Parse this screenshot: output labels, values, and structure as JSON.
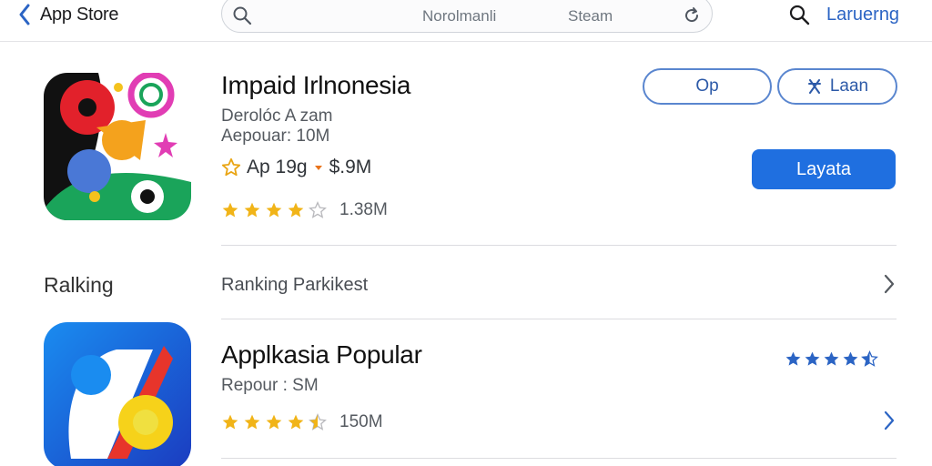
{
  "header": {
    "back_label": "App Store",
    "search_text": "Norolmanli",
    "search_secondary": "Steam",
    "lang_label": "Laruerng"
  },
  "featured": {
    "title": "Impaid Irlnonesia",
    "developer": "Derolóc A zam",
    "popular": "Aepouar: 10M",
    "meta": "Ap 19g",
    "meta_size": "$.9M",
    "rating_count": "1.38M",
    "rating_stars": 4.5,
    "open_button": "Op",
    "share_button": "Laan",
    "primary_button": "Layata"
  },
  "section": {
    "label": "Ralking",
    "link": "Ranking  Parkikest"
  },
  "popular_app": {
    "title": "Applkasia Popular",
    "subline": "Repour : SM",
    "rating_count": "150M",
    "rating_stars": 4.5,
    "blue_stars": 4.5
  },
  "colors": {
    "accent": "#1f6fe0",
    "star": "#f1b418",
    "blue_star": "#2b64c4"
  }
}
